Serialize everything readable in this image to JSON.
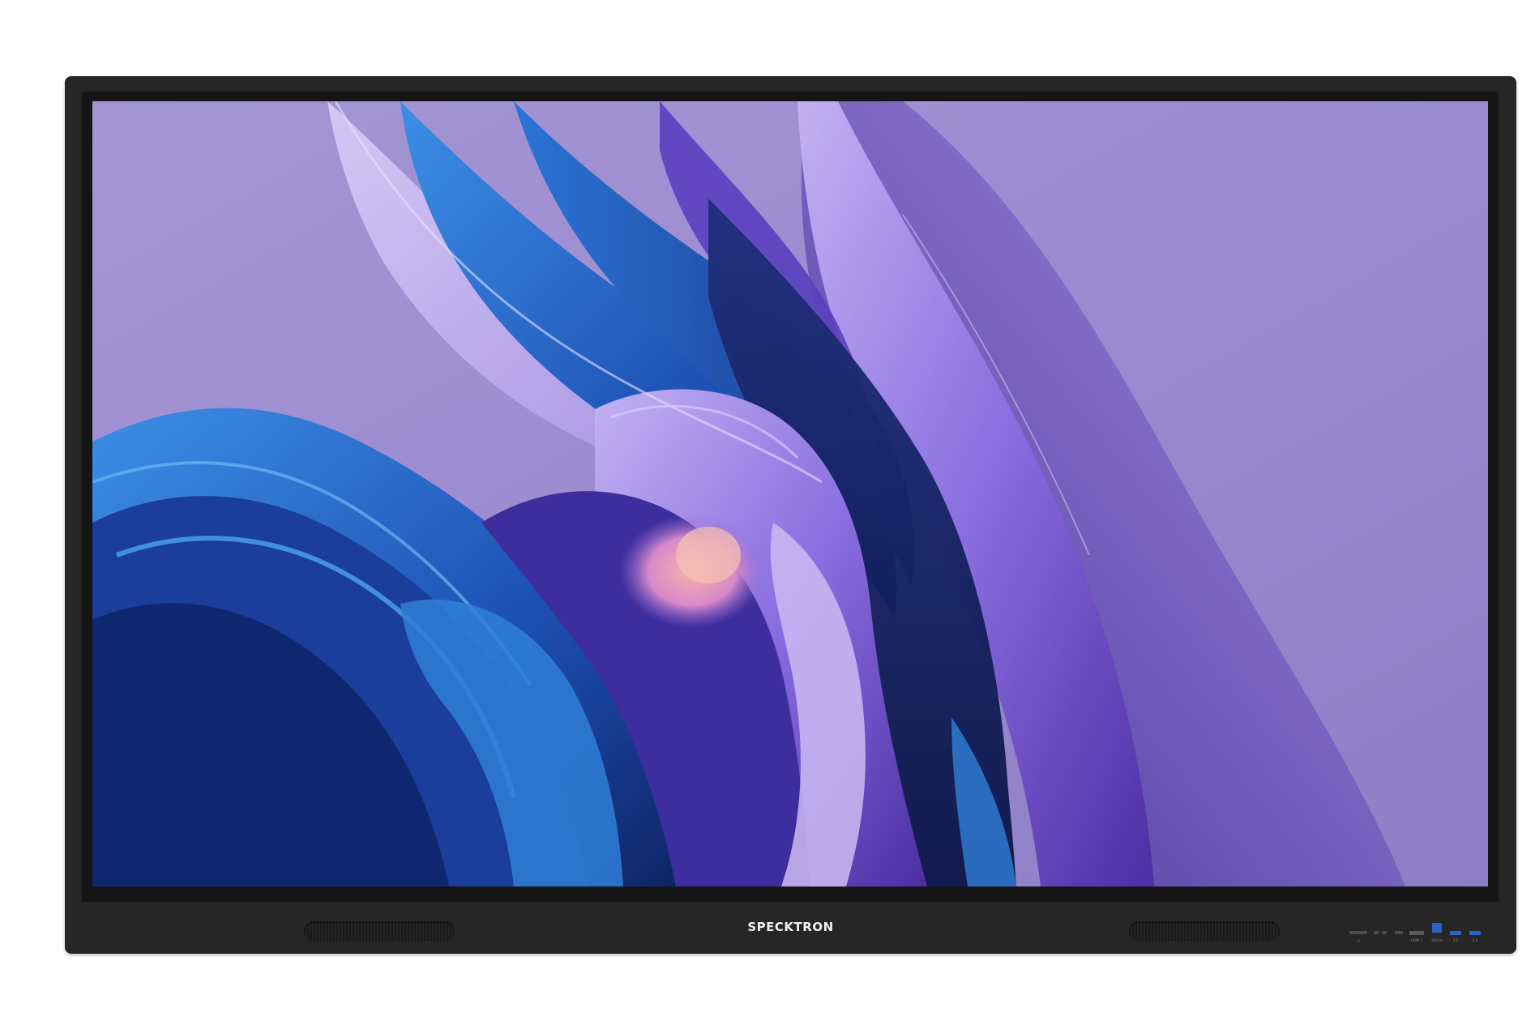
{
  "device": {
    "brand": "SPECKTRON",
    "frame_color": "#262626",
    "ports": [
      {
        "icon": "power-button",
        "label": "⊙"
      },
      {
        "icon": "audio-jack",
        "label": ""
      },
      {
        "icon": "usb-c-port",
        "label": ""
      },
      {
        "icon": "hdmi-port",
        "label": "HDMI 1"
      },
      {
        "icon": "usb-touch-port",
        "label": "TOUCH"
      },
      {
        "icon": "usb-port",
        "label": "3.0"
      },
      {
        "icon": "usb-port",
        "label": "3.0"
      }
    ]
  },
  "screen": {
    "wallpaper": "abstract-purple-blue-swirl",
    "colors": {
      "background": "#9d8fcf",
      "deep_blue": "#1b3a8c",
      "bright_blue": "#2f7fd8",
      "violet": "#6b4fc2",
      "lavender": "#b9a8ea",
      "pink_glow": "#f0a3b0"
    }
  }
}
